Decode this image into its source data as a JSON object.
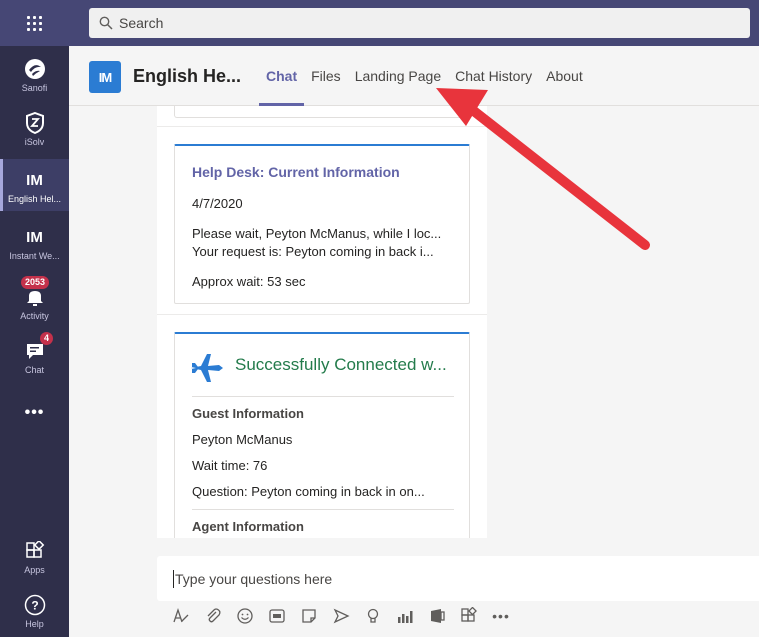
{
  "search": {
    "placeholder": "Search"
  },
  "rail": {
    "items": [
      {
        "label": "Sanofi",
        "glyph": "S"
      },
      {
        "label": "iSolv",
        "glyph": "S"
      },
      {
        "label": "English Hel...",
        "glyph": "IM"
      },
      {
        "label": "Instant We...",
        "glyph": "IM"
      },
      {
        "label": "Activity",
        "badge": "2053"
      },
      {
        "label": "Chat",
        "badge": "4"
      },
      {
        "label": "Apps"
      },
      {
        "label": "Help",
        "glyph": "?"
      }
    ]
  },
  "app": {
    "logo": "IM",
    "title": "English He...",
    "tabs": [
      {
        "label": "Chat",
        "active": true
      },
      {
        "label": "Files"
      },
      {
        "label": "Landing Page"
      },
      {
        "label": "Chat History"
      },
      {
        "label": "About"
      }
    ]
  },
  "card1": {
    "title": "Help Desk: Current Information",
    "date": "4/7/2020",
    "line1": "Please wait, Peyton McManus, while I loc...",
    "line2": "Your request is: Peyton coming in back i...",
    "wait": "Approx wait: 53 sec"
  },
  "card2": {
    "title": "Successfully Connected w...",
    "guest_heading": "Guest Information",
    "guest_name": "Peyton McManus",
    "wait_time": "Wait time: 76",
    "question": "Question: Peyton coming in back in on...",
    "agent_heading": "Agent Information"
  },
  "compose": {
    "placeholder": "Type your questions here"
  },
  "colors": {
    "accent": "#6264a7",
    "rail": "#2f2f4a",
    "topbar": "#464775",
    "success": "#237b4b",
    "annotation": "#e8343c"
  }
}
